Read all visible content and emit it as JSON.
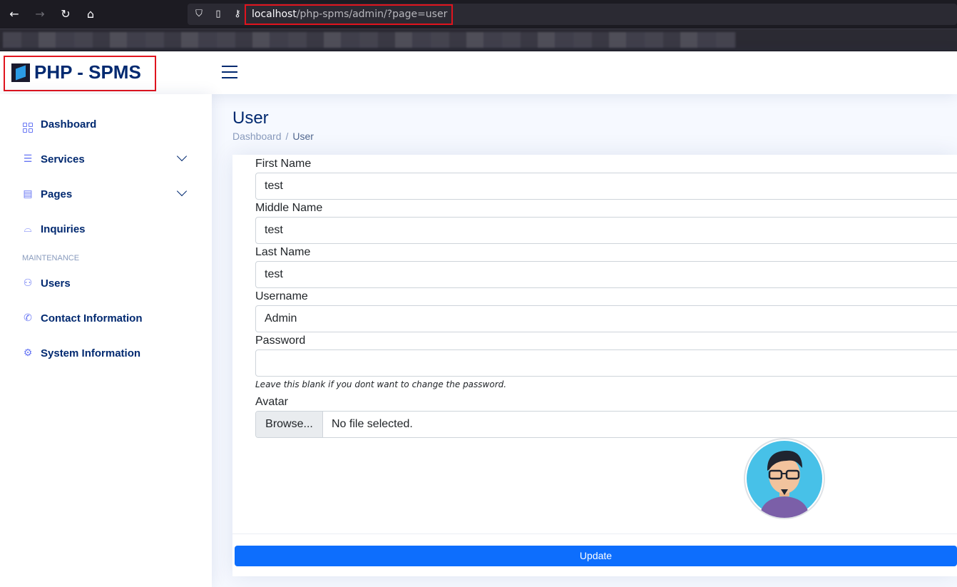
{
  "browser": {
    "url_host": "localhost",
    "url_path": "/php-spms/admin/?page=user"
  },
  "app": {
    "brand": "PHP - SPMS"
  },
  "sidebar": {
    "items": [
      {
        "label": "Dashboard",
        "icon": "grid-icon"
      },
      {
        "label": "Services",
        "icon": "layout-list-icon"
      },
      {
        "label": "Pages",
        "icon": "layout-icon"
      },
      {
        "label": "Inquiries",
        "icon": "inbox-icon"
      }
    ],
    "heading": "MAINTENANCE",
    "maintenance_items": [
      {
        "label": "Users",
        "icon": "people-icon"
      },
      {
        "label": "Contact Information",
        "icon": "telephone-icon"
      },
      {
        "label": "System Information",
        "icon": "gear-icon"
      }
    ]
  },
  "page": {
    "title": "User",
    "breadcrumb": [
      "Dashboard",
      "User"
    ]
  },
  "form": {
    "first_name_label": "First Name",
    "first_name_value": "test",
    "middle_name_label": "Middle Name",
    "middle_name_value": "test",
    "last_name_label": "Last Name",
    "last_name_value": "test",
    "username_label": "Username",
    "username_value": "Admin",
    "password_label": "Password",
    "password_value": "",
    "password_help": "Leave this blank if you dont want to change the password.",
    "avatar_label": "Avatar",
    "browse_label": "Browse...",
    "file_status": "No file selected.",
    "submit_label": "Update"
  },
  "colors": {
    "brand": "#012970",
    "primary_button": "#0d6efd",
    "highlight_box": "#e0141e"
  }
}
